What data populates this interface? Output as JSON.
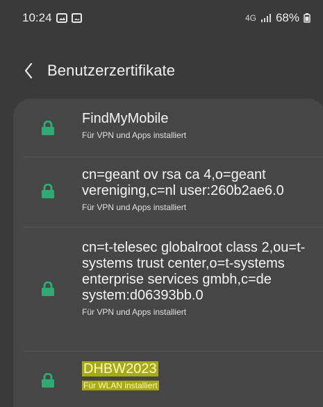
{
  "status_bar": {
    "time": "10:24",
    "network_label": "4G",
    "battery": "68%"
  },
  "header": {
    "back_icon": "chevron-left-icon",
    "title": "Benutzerzertifikate"
  },
  "certificates": [
    {
      "title": "FindMyMobile",
      "subtitle": "Für VPN und Apps installiert",
      "icon": "lock-icon",
      "highlighted": false
    },
    {
      "title": "cn=geant ov rsa ca 4,o=geant vereniging,c=nl user:260b2ae6.0",
      "subtitle": "Für VPN und Apps installiert",
      "icon": "lock-icon",
      "highlighted": false
    },
    {
      "title": "cn=t-telesec globalroot class 2,ou=t-systems trust center,o=t-systems enterprise services gmbh,c=de system:d06393bb.0",
      "subtitle": "Für VPN und Apps installiert",
      "icon": "lock-icon",
      "highlighted": false
    },
    {
      "title": "DHBW2023",
      "subtitle": "Für WLAN installiert",
      "icon": "lock-icon",
      "highlighted": true
    }
  ],
  "colors": {
    "background": "#3a3a3a",
    "card": "#464646",
    "lock_green": "#2faa73",
    "highlight": "#b5ba0d"
  }
}
